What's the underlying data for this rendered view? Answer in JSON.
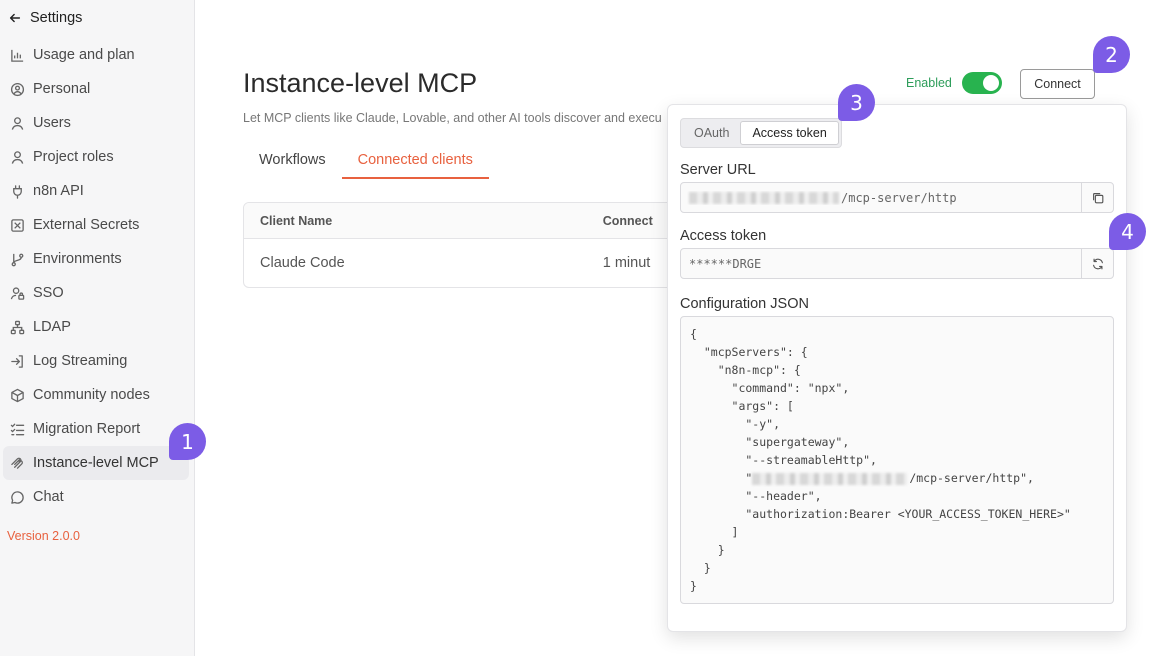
{
  "sidebar": {
    "back_icon": "arrow-left-icon",
    "title": "Settings",
    "items": [
      {
        "label": "Usage and plan",
        "icon": "bar-chart-icon"
      },
      {
        "label": "Personal",
        "icon": "user-circle-icon"
      },
      {
        "label": "Users",
        "icon": "user-icon"
      },
      {
        "label": "Project roles",
        "icon": "user-icon"
      },
      {
        "label": "n8n API",
        "icon": "plug-icon"
      },
      {
        "label": "External Secrets",
        "icon": "vault-icon"
      },
      {
        "label": "Environments",
        "icon": "git-branch-icon"
      },
      {
        "label": "SSO",
        "icon": "user-lock-icon"
      },
      {
        "label": "LDAP",
        "icon": "network-icon"
      },
      {
        "label": "Log Streaming",
        "icon": "sign-in-icon"
      },
      {
        "label": "Community nodes",
        "icon": "cube-icon"
      },
      {
        "label": "Migration Report",
        "icon": "list-check-icon"
      },
      {
        "label": "Instance-level MCP",
        "icon": "mcp-icon"
      },
      {
        "label": "Chat",
        "icon": "message-circle-icon"
      }
    ],
    "version": "Version 2.0.0"
  },
  "badges": [
    "1",
    "2",
    "3",
    "4"
  ],
  "main": {
    "title": "Instance-level MCP",
    "subtitle": "Let MCP clients like Claude, Lovable, and other AI tools discover and execu",
    "tabs": [
      "Workflows",
      "Connected clients"
    ],
    "table": {
      "headers": [
        "Client Name",
        "Connect"
      ],
      "rows": [
        [
          "Claude Code",
          "1 minut"
        ]
      ]
    },
    "enabled_label": "Enabled",
    "connect_label": "Connect"
  },
  "popover": {
    "auth_tabs": [
      "OAuth",
      "Access token"
    ],
    "server_url_label": "Server URL",
    "server_url_value": "/mcp-server/http",
    "access_token_label": "Access token",
    "access_token_value": "******DRGE",
    "config_label": "Configuration JSON",
    "config_lines": [
      "{",
      "  \"mcpServers\": {",
      "    \"n8n-mcp\": {",
      "      \"command\": \"npx\",",
      "      \"args\": [",
      "        \"-y\",",
      "        \"supergateway\",",
      "        \"--streamableHttp\",",
      "        \"/mcp-server/http\",",
      "        \"--header\",",
      "        \"authorization:Bearer <YOUR_ACCESS_TOKEN_HERE>\"",
      "      ]",
      "    }",
      "  }",
      "}"
    ]
  },
  "colors": {
    "accent": "#e8613f",
    "toggle_on": "#28b34f",
    "badge": "#7c5ce6"
  }
}
